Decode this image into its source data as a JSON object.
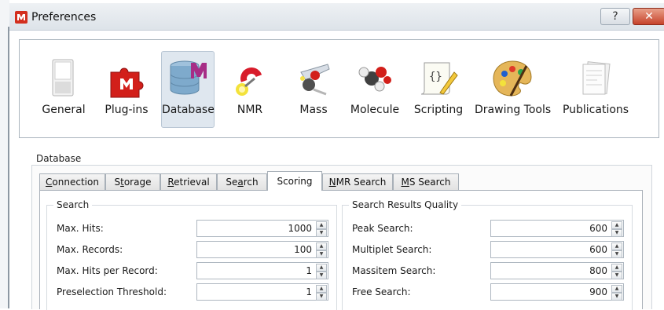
{
  "window": {
    "title": "Preferences",
    "help_label": "?",
    "close_label": "✕"
  },
  "categories": [
    {
      "label": "General",
      "icon": "switch-icon",
      "selected": false
    },
    {
      "label": "Plug-ins",
      "icon": "puzzle-icon",
      "selected": false
    },
    {
      "label": "Database",
      "icon": "database-icon",
      "selected": true
    },
    {
      "label": "NMR",
      "icon": "magnet-icon",
      "selected": false
    },
    {
      "label": "Mass",
      "icon": "mass-spec-icon",
      "selected": false
    },
    {
      "label": "Molecule",
      "icon": "molecule-icon",
      "selected": false
    },
    {
      "label": "Scripting",
      "icon": "script-icon",
      "selected": false
    },
    {
      "label": "Drawing Tools",
      "icon": "palette-icon",
      "selected": false
    },
    {
      "label": "Publications",
      "icon": "document-icon",
      "selected": false
    }
  ],
  "database": {
    "group_label": "Database",
    "tabs": [
      {
        "label": "Connection",
        "mnemonic": "C",
        "rest": "onnection"
      },
      {
        "label": "Storage",
        "mnemonic": "t",
        "pre": "S",
        "rest": "orage"
      },
      {
        "label": "Retrieval",
        "mnemonic": "R",
        "rest": "etrieval"
      },
      {
        "label": "Search",
        "mnemonic": "a",
        "pre": "Se",
        "rest": "rch"
      },
      {
        "label": "Scoring",
        "active": true
      },
      {
        "label": "NMR Search",
        "mnemonic": "N",
        "rest": "MR Search"
      },
      {
        "label": "MS Search",
        "mnemonic": "M",
        "rest": "S Search"
      }
    ],
    "search": {
      "title": "Search",
      "rows": [
        {
          "label": "Max. Hits:",
          "value": "1000"
        },
        {
          "label": "Max. Records:",
          "value": "100"
        },
        {
          "label": "Max. Hits per Record:",
          "value": "1"
        },
        {
          "label": "Preselection Threshold:",
          "value": "1"
        }
      ]
    },
    "quality": {
      "title": "Search Results Quality",
      "rows": [
        {
          "label": "Peak Search:",
          "value": "600"
        },
        {
          "label": "Multiplet Search:",
          "value": "600"
        },
        {
          "label": "Massitem Search:",
          "value": "800"
        },
        {
          "label": "Free Search:",
          "value": "900"
        }
      ]
    }
  },
  "colors": {
    "selected_bg": "#dfe7ef",
    "close_red": "#c6432b"
  }
}
